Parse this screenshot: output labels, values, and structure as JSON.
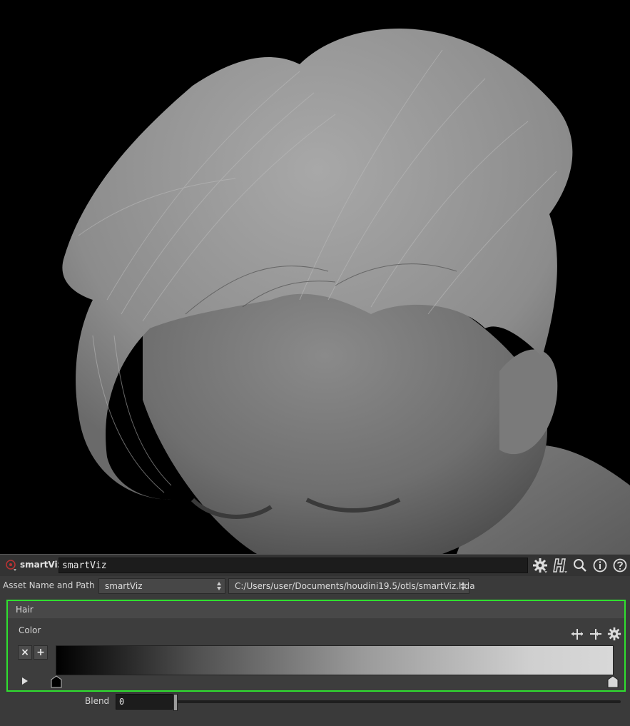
{
  "node": {
    "type_label": "smartViz",
    "name_value": "smartViz"
  },
  "toolbar": {
    "icons": [
      "gear-icon",
      "houdini-help-icon",
      "search-icon",
      "info-icon",
      "help-icon"
    ]
  },
  "asset": {
    "label": "Asset Name and Path",
    "name_value": "smartViz",
    "path_value": "C:/Users/user/Documents/houdini19.5/otls/smartViz.hda"
  },
  "folder": {
    "tab_label": "Hair",
    "color_label": "Color",
    "remove_key_label": "×",
    "add_key_label": "+",
    "ramp": {
      "keys": [
        {
          "position": 0.0,
          "color": "#000000"
        },
        {
          "position": 1.0,
          "color": "#d8d8d8"
        }
      ]
    }
  },
  "blend": {
    "label": "Blend",
    "value": "0"
  },
  "colors": {
    "highlight": "#2fe02f",
    "panel_bg": "#3a3a3a",
    "field_bg": "#1c1c1c"
  }
}
